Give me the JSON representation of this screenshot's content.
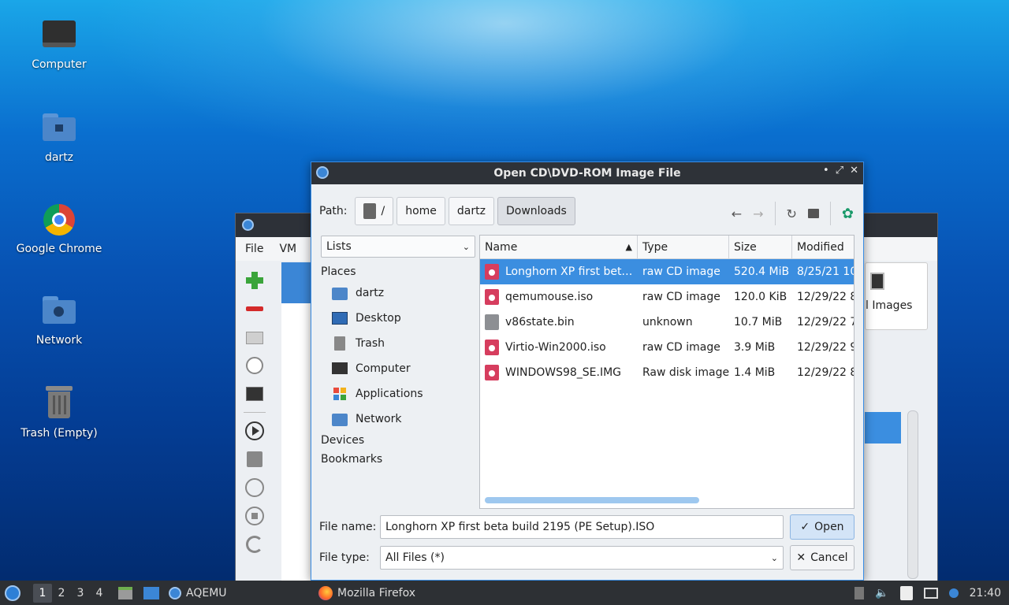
{
  "desktop": {
    "icons": [
      {
        "label": "Computer",
        "icon": "computer-icon"
      },
      {
        "label": "dartz",
        "icon": "home-folder-icon"
      },
      {
        "label": "Google Chrome",
        "icon": "chrome-icon"
      },
      {
        "label": "Network",
        "icon": "network-folder-icon"
      },
      {
        "label": "Trash (Empty)",
        "icon": "trash-icon"
      }
    ]
  },
  "bg_window": {
    "menu": [
      "File",
      "VM"
    ],
    "partial_text": "l Images"
  },
  "dialog": {
    "title": "Open CD\\DVD-ROM Image File",
    "window_buttons": [
      "•",
      "✖",
      "✕"
    ],
    "path_label": "Path:",
    "breadcrumbs": [
      "/",
      "home",
      "dartz",
      "Downloads"
    ],
    "active_crumb": "Downloads",
    "lists_combo": "Lists",
    "places": {
      "header": "Places",
      "items": [
        "dartz",
        "Desktop",
        "Trash",
        "Computer",
        "Applications",
        "Network"
      ],
      "devices": "Devices",
      "bookmarks": "Bookmarks"
    },
    "columns": [
      "Name",
      "Type",
      "Size",
      "Modified"
    ],
    "files": [
      {
        "name": "Longhorn XP first bet…",
        "type": "raw CD image",
        "size": "520.4 MiB",
        "modified": "8/25/21 10",
        "icon": "disc-image-icon",
        "selected": true
      },
      {
        "name": "qemumouse.iso",
        "type": "raw CD image",
        "size": "120.0 KiB",
        "modified": "12/29/22 8",
        "icon": "disc-image-icon",
        "selected": false
      },
      {
        "name": "v86state.bin",
        "type": "unknown",
        "size": "10.7 MiB",
        "modified": "12/29/22 7",
        "icon": "unknown-file-icon",
        "selected": false
      },
      {
        "name": "Virtio-Win2000.iso",
        "type": "raw CD image",
        "size": "3.9 MiB",
        "modified": "12/29/22 9",
        "icon": "disc-image-icon",
        "selected": false
      },
      {
        "name": "WINDOWS98_SE.IMG",
        "type": "Raw disk image",
        "size": "1.4 MiB",
        "modified": "12/29/22 8",
        "icon": "disc-image-icon",
        "selected": false
      }
    ],
    "file_name_label": "File name:",
    "file_name_value": "Longhorn XP first beta build 2195 (PE Setup).ISO",
    "file_type_label": "File type:",
    "file_type_value": "All Files (*)",
    "open_label": "Open",
    "cancel_label": "Cancel"
  },
  "taskbar": {
    "workspaces": [
      "1",
      "2",
      "3",
      "4"
    ],
    "active_workspace": "1",
    "tasks": [
      "AQEMU",
      "Mozilla Firefox"
    ],
    "clock": "21:40"
  },
  "colors": {
    "selection": "#3b8ee0",
    "titlebar": "#2e3238",
    "taskbar": "#2d3034"
  }
}
